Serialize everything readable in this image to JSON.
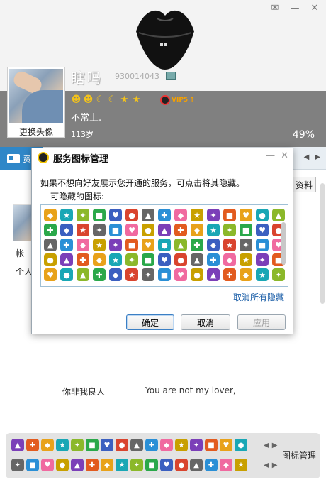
{
  "window": {
    "controls": [
      "✉",
      "—",
      "✕"
    ]
  },
  "profile": {
    "nickname": "瞎吗",
    "qq_number": "930014043",
    "change_avatar": "更换头像",
    "signature": "不常上.",
    "age": "113岁",
    "completion": "49%",
    "vip_label": "VIP5",
    "level_icons": [
      "sun",
      "sun",
      "moon",
      "moon",
      "star",
      "star"
    ]
  },
  "tabs": {
    "active_label": "资",
    "arrows": [
      "◀",
      "▶"
    ]
  },
  "background": {
    "edit_button": "资料",
    "account_label": "帐",
    "personal_label": "个人",
    "song_name": "你非我良人",
    "song_lyric": "You are not my lover,"
  },
  "dialog": {
    "title": "服务图标管理",
    "controls": [
      "—",
      "✕"
    ],
    "description": "如果不想向好友展示您开通的服务，可点击将其隐藏。",
    "hideable_label": "可隐藏的图标:",
    "unhide_all": "取消所有隐藏",
    "ok": "确定",
    "cancel": "取消",
    "apply": "应用"
  },
  "tray": {
    "manage_label": "图标管理",
    "arrows": [
      "◀",
      "▶"
    ]
  },
  "colors": {
    "accent": "#2f87c8",
    "header_band": "#808080",
    "link": "#1c5fa8"
  }
}
